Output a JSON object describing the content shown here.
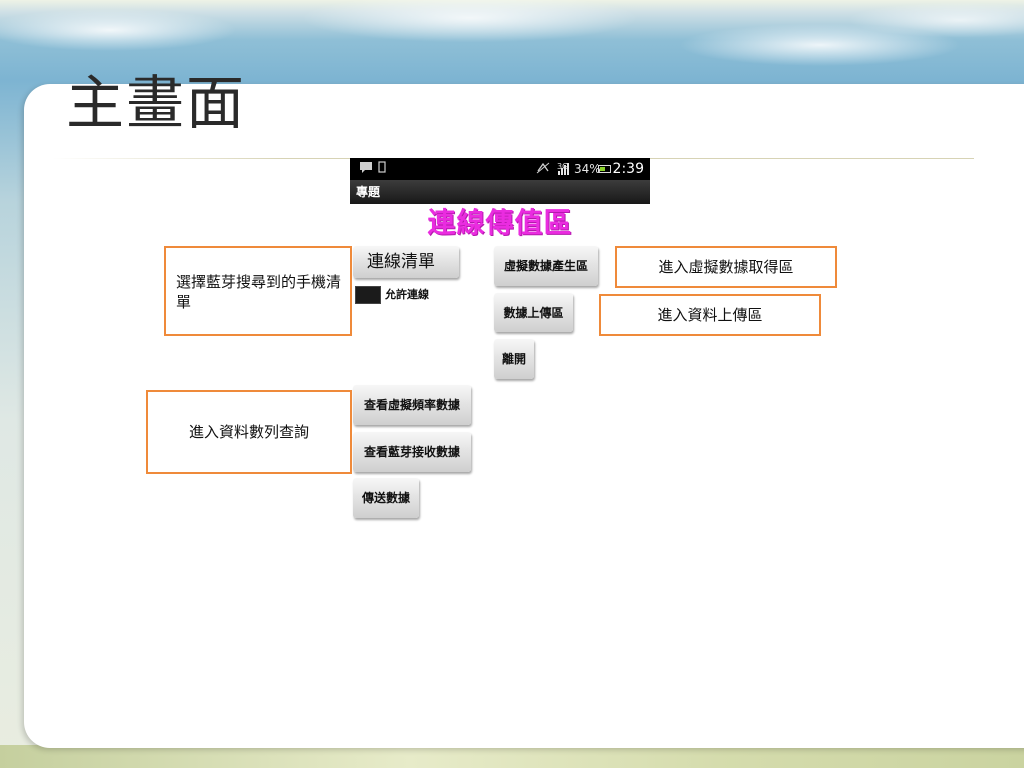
{
  "slide": {
    "title": "主畫面"
  },
  "phone": {
    "status_bar": {
      "notification_icons": [
        "chat-icon",
        "phone-icon"
      ],
      "network_label": "3G",
      "battery_text": "34%",
      "time": "2:39"
    },
    "app_title": "專題",
    "screen_heading": "連線傳值區",
    "buttons": {
      "connection_list": "連線清單",
      "virtual_data_generate": "虛擬數據產生區",
      "data_upload": "數據上傳區",
      "leave": "離開",
      "view_virtual_freq": "查看虛擬頻率數據",
      "view_bt_received": "查看藍芽接收數據",
      "send_data": "傳送數據"
    },
    "toggle": {
      "label": "允許連線",
      "checked": true
    }
  },
  "callouts": {
    "select_bt": "選擇藍芽搜尋到的手機清單",
    "virtual_data": "進入虛擬數據取得區",
    "data_upload": "進入資料上傳區",
    "data_query": "進入資料數列查詢"
  },
  "colors": {
    "heading_magenta": "#ea2ce0",
    "callout_border": "#ef8a3a",
    "status_bar": "#000000"
  }
}
